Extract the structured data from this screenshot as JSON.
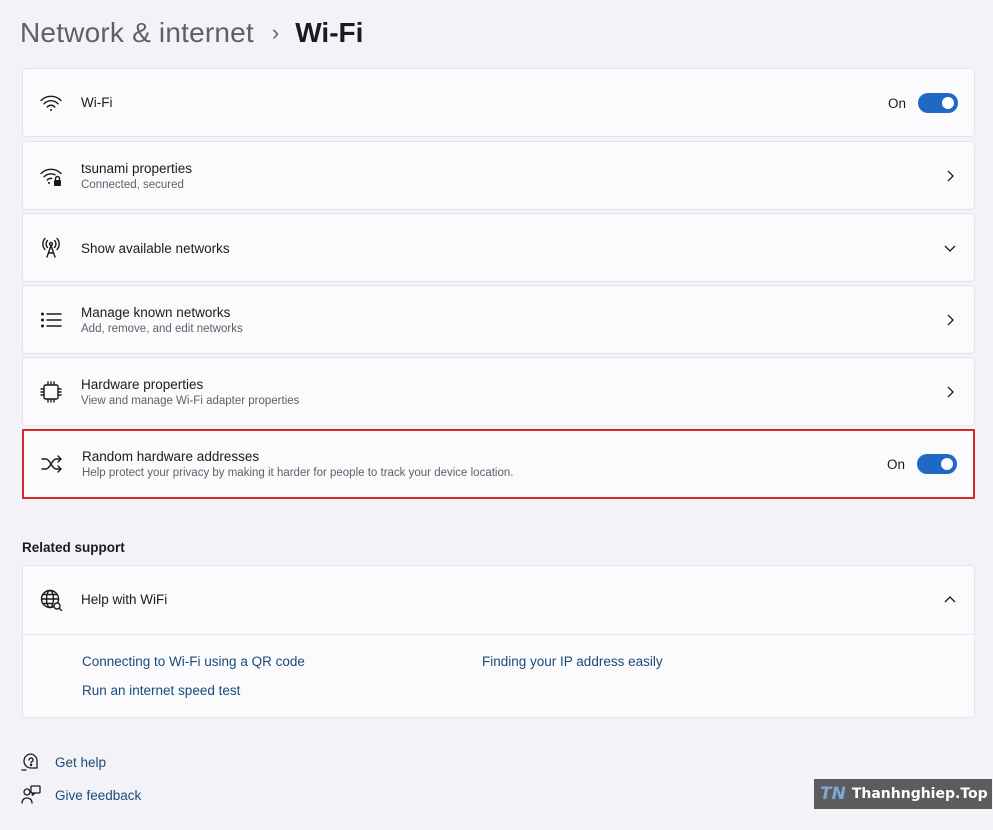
{
  "breadcrumb": {
    "parent": "Network & internet",
    "separator": "›",
    "current": "Wi-Fi"
  },
  "cards": {
    "wifi": {
      "title": "Wi-Fi",
      "toggle_label": "On",
      "toggle_on": true,
      "icon": "wifi-icon"
    },
    "network_properties": {
      "title": "tsunami properties",
      "subtitle": "Connected, secured",
      "icon": "wifi-lock-icon"
    },
    "available_networks": {
      "title": "Show available networks",
      "icon": "antenna-icon"
    },
    "known_networks": {
      "title": "Manage known networks",
      "subtitle": "Add, remove, and edit networks",
      "icon": "list-icon"
    },
    "hardware_properties": {
      "title": "Hardware properties",
      "subtitle": "View and manage Wi-Fi adapter properties",
      "icon": "chip-icon"
    },
    "random_addresses": {
      "title": "Random hardware addresses",
      "subtitle": "Help protect your privacy by making it harder for people to track your device location.",
      "toggle_label": "On",
      "toggle_on": true,
      "icon": "shuffle-icon"
    }
  },
  "related_support": {
    "title": "Related support",
    "help": {
      "title": "Help with WiFi",
      "icon": "globe-icon",
      "links": [
        "Connecting to Wi-Fi using a QR code",
        "Finding your IP address easily",
        "Run an internet speed test"
      ]
    }
  },
  "footer": {
    "get_help": "Get help",
    "give_feedback": "Give feedback"
  },
  "watermark": {
    "logo": "TN",
    "text": "Thanhnghiep.Top"
  },
  "colors": {
    "accent": "#1f68c4",
    "highlight": "#d4282f",
    "link": "#1a4a7a",
    "background": "#f3f2f7"
  }
}
